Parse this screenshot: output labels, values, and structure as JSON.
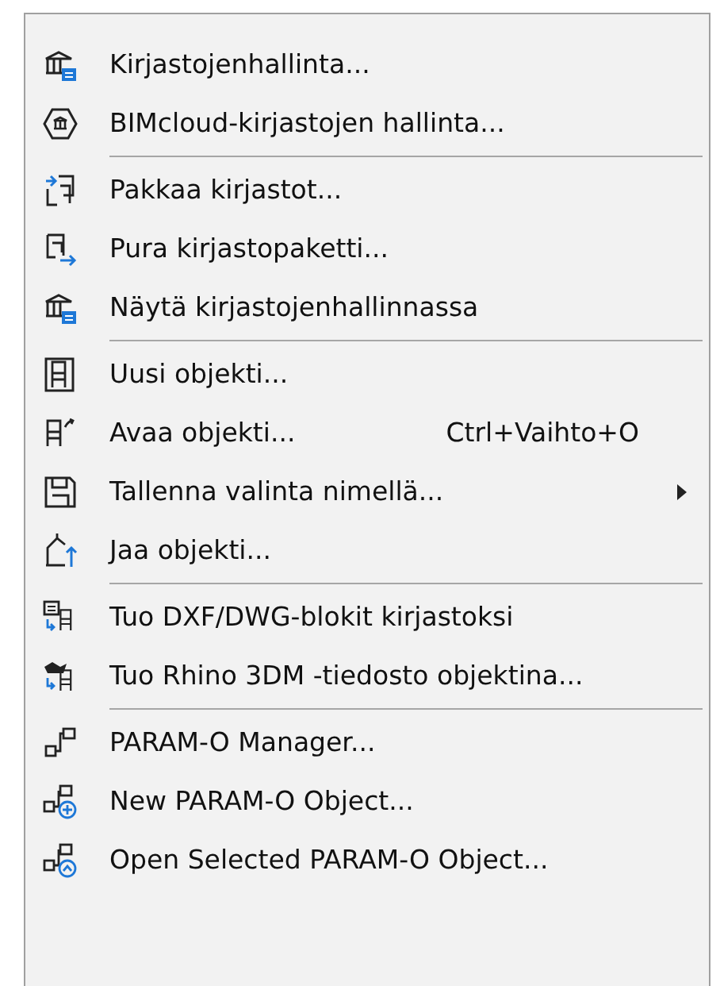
{
  "menu": {
    "groups": [
      {
        "items": [
          {
            "label": "Kirjastojenhallinta...",
            "has_submenu": false
          },
          {
            "label": "BIMcloud-kirjastojen hallinta...",
            "has_submenu": false
          }
        ]
      },
      {
        "items": [
          {
            "label": "Pakkaa kirjastot...",
            "has_submenu": false
          },
          {
            "label": "Pura kirjastopaketti...",
            "has_submenu": false
          },
          {
            "label": "Näytä kirjastojenhallinnassa",
            "has_submenu": false
          }
        ]
      },
      {
        "items": [
          {
            "label": "Uusi objekti...",
            "has_submenu": false
          },
          {
            "label": "Avaa objekti...",
            "shortcut": "Ctrl+Vaihto+O",
            "has_submenu": false
          },
          {
            "label": "Tallenna valinta nimellä...",
            "has_submenu": true
          },
          {
            "label": "Jaa objekti...",
            "has_submenu": false
          }
        ]
      },
      {
        "items": [
          {
            "label": "Tuo DXF/DWG-blokit kirjastoksi",
            "has_submenu": false
          },
          {
            "label": "Tuo Rhino 3DM -tiedosto objektina...",
            "has_submenu": false
          }
        ]
      },
      {
        "items": [
          {
            "label": "PARAM-O Manager...",
            "has_submenu": false
          },
          {
            "label": "New PARAM-O Object...",
            "has_submenu": false
          },
          {
            "label": "Open Selected PARAM-O Object...",
            "has_submenu": false
          }
        ]
      }
    ]
  }
}
